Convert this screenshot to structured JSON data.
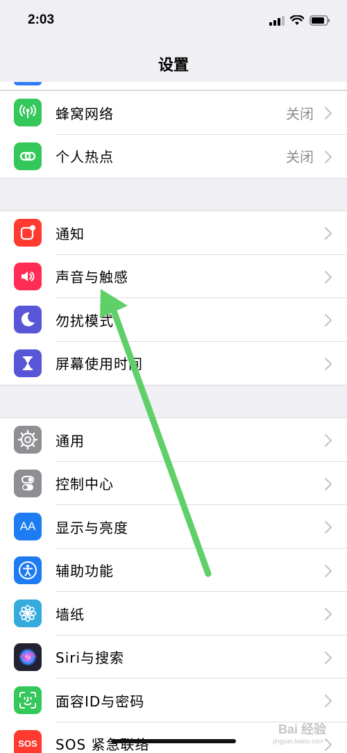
{
  "status_bar": {
    "time": "2:03"
  },
  "nav": {
    "title": "设置"
  },
  "groups": {
    "network": [
      {
        "label": "蜂窝网络",
        "value": "关闭",
        "icon": "cellular-icon",
        "color": "#34c759"
      },
      {
        "label": "个人热点",
        "value": "关闭",
        "icon": "hotspot-icon",
        "color": "#34c759"
      }
    ],
    "notify": [
      {
        "label": "通知",
        "icon": "notifications-icon",
        "color": "#ff3b30"
      },
      {
        "label": "声音与触感",
        "icon": "sound-icon",
        "color": "#ff2d55"
      },
      {
        "label": "勿扰模式",
        "icon": "moon-icon",
        "color": "#5856d6"
      },
      {
        "label": "屏幕使用时间",
        "icon": "hourglass-icon",
        "color": "#5856d6"
      }
    ],
    "general": [
      {
        "label": "通用",
        "icon": "gear-icon",
        "color": "#8e8e93"
      },
      {
        "label": "控制中心",
        "icon": "toggles-icon",
        "color": "#8e8e93"
      },
      {
        "label": "显示与亮度",
        "icon": "display-icon",
        "color": "#1e7cf2",
        "glyph": "AA"
      },
      {
        "label": "辅助功能",
        "icon": "accessibility-icon",
        "color": "#1e7cf2"
      },
      {
        "label": "墙纸",
        "icon": "wallpaper-icon",
        "color": "#35aadc"
      },
      {
        "label": "Siri与搜索",
        "icon": "siri-icon",
        "color": "#222233"
      },
      {
        "label": "面容ID与密码",
        "icon": "faceid-icon",
        "color": "#34c759"
      },
      {
        "label": "SOS 紧急联络",
        "icon": "sos-icon",
        "color": "#ff3b30",
        "glyph": "SOS"
      }
    ]
  },
  "watermark": {
    "text": "Bai 经验",
    "sub": "jingyan.baidu.com"
  },
  "annotation": {
    "arrow_color": "#5fd068"
  }
}
